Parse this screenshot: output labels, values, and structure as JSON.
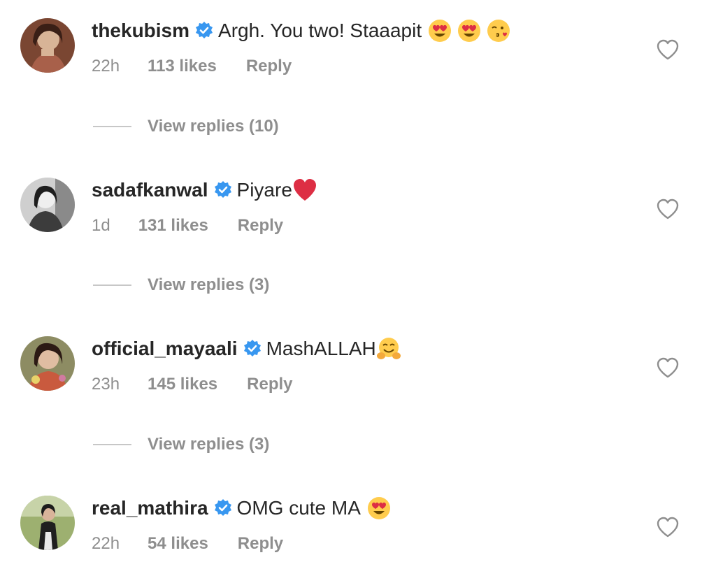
{
  "comments": [
    {
      "username": "thekubism",
      "text": "Argh. You two! Staaapit",
      "emojis": [
        "heart-eyes-emoji",
        "heart-eyes-emoji",
        "kissing-wink-emoji"
      ],
      "time": "22h",
      "likes": "113 likes",
      "reply": "Reply",
      "view_replies": "View replies (10)",
      "avatar_colors": [
        "#6b3a2a",
        "#c9a58a"
      ]
    },
    {
      "username": "sadafkanwal",
      "text": "Piyare",
      "emojis": [
        "red-heart-emoji"
      ],
      "time": "1d",
      "likes": "131 likes",
      "reply": "Reply",
      "view_replies": "View replies (3)",
      "avatar_colors": [
        "#3a3a3a",
        "#d9d9d9"
      ]
    },
    {
      "username": "official_mayaali",
      "text": "MashALLAH",
      "emojis": [
        "hugging-emoji"
      ],
      "time": "23h",
      "likes": "145 likes",
      "reply": "Reply",
      "view_replies": "View replies (3)",
      "avatar_colors": [
        "#4e5a3a",
        "#d6b39a"
      ]
    },
    {
      "username": "real_mathira",
      "text": "OMG cute MA",
      "emojis": [
        "heart-eyes-emoji"
      ],
      "time": "22h",
      "likes": "54 likes",
      "reply": "Reply",
      "avatar_colors": [
        "#8fa36a",
        "#2b2b2b"
      ]
    }
  ],
  "colors": {
    "username": "#262626",
    "meta": "#8e8e8e",
    "verified_blue": "#3897f0",
    "divider": "#c7c7c7"
  }
}
